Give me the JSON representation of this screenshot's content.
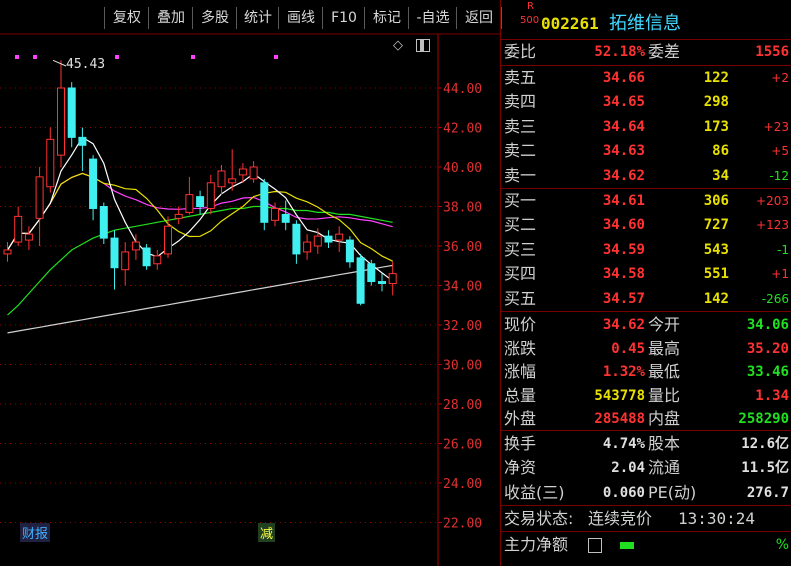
{
  "toolbar": {
    "buttons": [
      "复权",
      "叠加",
      "多股",
      "统计",
      "画线",
      "F10",
      "标记",
      "-自选",
      "返回"
    ]
  },
  "chart": {
    "y_ticks": [
      "44.00",
      "42.00",
      "40.00",
      "38.00",
      "36.00",
      "34.00",
      "32.00",
      "30.00",
      "28.00",
      "26.00",
      "24.00",
      "22.00"
    ],
    "high_label": "45.43",
    "tag_caibao": "财报",
    "tag_jian": "减",
    "colors": {
      "up": "#ff3232",
      "down": "#40f0f0",
      "ma5": "#ffffff",
      "ma10": "#e8e000",
      "ma20": "#ff40ff",
      "ma30": "#20e020",
      "ma60": "#d0d0d0"
    },
    "candles": [
      {
        "o": 35.6,
        "c": 35.8,
        "h": 36.2,
        "l": 35.2
      },
      {
        "o": 36.2,
        "c": 37.5,
        "h": 38.0,
        "l": 36.0
      },
      {
        "o": 36.3,
        "c": 36.6,
        "h": 37.0,
        "l": 35.8
      },
      {
        "o": 37.4,
        "c": 39.5,
        "h": 40.0,
        "l": 36.0
      },
      {
        "o": 39.0,
        "c": 41.4,
        "h": 42.0,
        "l": 38.7
      },
      {
        "o": 40.6,
        "c": 44.0,
        "h": 45.4,
        "l": 40.0
      },
      {
        "o": 44.0,
        "c": 41.5,
        "h": 44.3,
        "l": 41.0
      },
      {
        "o": 41.5,
        "c": 41.1,
        "h": 42.0,
        "l": 39.8
      },
      {
        "o": 40.4,
        "c": 37.9,
        "h": 40.6,
        "l": 37.3
      },
      {
        "o": 38.0,
        "c": 36.4,
        "h": 38.2,
        "l": 36.1
      },
      {
        "o": 36.4,
        "c": 34.9,
        "h": 36.8,
        "l": 33.8
      },
      {
        "o": 34.8,
        "c": 35.7,
        "h": 36.2,
        "l": 34.0
      },
      {
        "o": 35.8,
        "c": 36.2,
        "h": 36.6,
        "l": 35.3
      },
      {
        "o": 35.9,
        "c": 35.0,
        "h": 36.1,
        "l": 34.8
      },
      {
        "o": 35.1,
        "c": 35.5,
        "h": 35.8,
        "l": 34.8
      },
      {
        "o": 35.6,
        "c": 37.0,
        "h": 37.5,
        "l": 35.4
      },
      {
        "o": 37.4,
        "c": 37.6,
        "h": 38.0,
        "l": 37.1
      },
      {
        "o": 37.7,
        "c": 38.6,
        "h": 39.5,
        "l": 37.6
      },
      {
        "o": 38.5,
        "c": 38.0,
        "h": 38.8,
        "l": 37.6
      },
      {
        "o": 37.9,
        "c": 39.2,
        "h": 39.6,
        "l": 37.6
      },
      {
        "o": 39.0,
        "c": 39.8,
        "h": 40.1,
        "l": 38.6
      },
      {
        "o": 39.2,
        "c": 39.4,
        "h": 40.9,
        "l": 38.8
      },
      {
        "o": 39.6,
        "c": 39.9,
        "h": 40.2,
        "l": 39.2
      },
      {
        "o": 39.4,
        "c": 40.0,
        "h": 40.3,
        "l": 39.2
      },
      {
        "o": 39.2,
        "c": 37.2,
        "h": 39.4,
        "l": 36.8
      },
      {
        "o": 37.3,
        "c": 37.9,
        "h": 38.2,
        "l": 37.0
      },
      {
        "o": 37.6,
        "c": 37.2,
        "h": 38.3,
        "l": 36.8
      },
      {
        "o": 37.1,
        "c": 35.6,
        "h": 37.3,
        "l": 35.1
      },
      {
        "o": 35.7,
        "c": 36.2,
        "h": 36.6,
        "l": 35.3
      },
      {
        "o": 36.0,
        "c": 36.5,
        "h": 36.9,
        "l": 35.6
      },
      {
        "o": 36.5,
        "c": 36.2,
        "h": 36.8,
        "l": 35.9
      },
      {
        "o": 36.3,
        "c": 36.6,
        "h": 37.0,
        "l": 35.7
      },
      {
        "o": 36.3,
        "c": 35.2,
        "h": 36.5,
        "l": 34.9
      },
      {
        "o": 35.4,
        "c": 33.1,
        "h": 35.6,
        "l": 33.0
      },
      {
        "o": 35.1,
        "c": 34.2,
        "h": 35.3,
        "l": 34.0
      },
      {
        "o": 34.2,
        "c": 34.1,
        "h": 34.6,
        "l": 33.7
      },
      {
        "o": 34.1,
        "c": 34.6,
        "h": 35.2,
        "l": 33.5
      }
    ]
  },
  "stock": {
    "badge_top": "R",
    "badge_bottom": "500",
    "code": "002261",
    "name": "拓维信息"
  },
  "weibi": {
    "label1": "委比",
    "value1": "52.18%",
    "label2": "委差",
    "value2": "1556"
  },
  "asks": [
    {
      "label": "卖五",
      "price": "34.66",
      "vol": "122",
      "chg": "+2"
    },
    {
      "label": "卖四",
      "price": "34.65",
      "vol": "298",
      "chg": ""
    },
    {
      "label": "卖三",
      "price": "34.64",
      "vol": "173",
      "chg": "+23"
    },
    {
      "label": "卖二",
      "price": "34.63",
      "vol": "86",
      "chg": "+5"
    },
    {
      "label": "卖一",
      "price": "34.62",
      "vol": "34",
      "chg": "-12"
    }
  ],
  "bids": [
    {
      "label": "买一",
      "price": "34.61",
      "vol": "306",
      "chg": "+203"
    },
    {
      "label": "买二",
      "price": "34.60",
      "vol": "727",
      "chg": "+123"
    },
    {
      "label": "买三",
      "price": "34.59",
      "vol": "543",
      "chg": "-1"
    },
    {
      "label": "买四",
      "price": "34.58",
      "vol": "551",
      "chg": "+1"
    },
    {
      "label": "买五",
      "price": "34.57",
      "vol": "142",
      "chg": "-266"
    }
  ],
  "quote": [
    {
      "l1": "现价",
      "v1": "34.62",
      "l2": "今开",
      "v2": "34.06"
    },
    {
      "l1": "涨跌",
      "v1": "0.45",
      "l2": "最高",
      "v2": "35.20"
    },
    {
      "l1": "涨幅",
      "v1": "1.32%",
      "l2": "最低",
      "v2": "33.46"
    },
    {
      "l1": "总量",
      "v1": "543778",
      "l2": "量比",
      "v2": "1.34"
    },
    {
      "l1": "外盘",
      "v1": "285488",
      "l2": "内盘",
      "v2": "258290"
    }
  ],
  "fund": [
    {
      "l1": "换手",
      "v1": "4.74%",
      "l2": "股本",
      "v2": "12.6亿"
    },
    {
      "l1": "净资",
      "v1": "2.04",
      "l2": "流通",
      "v2": "11.5亿"
    },
    {
      "l1": "收益(三)",
      "v1": "0.060",
      "l2": "PE(动)",
      "v2": "276.7"
    }
  ],
  "status": {
    "label": "交易状态:",
    "value": "连续竞价",
    "time": "13:30:24"
  },
  "main_force": {
    "label": "主力净额",
    "pct": "%"
  }
}
